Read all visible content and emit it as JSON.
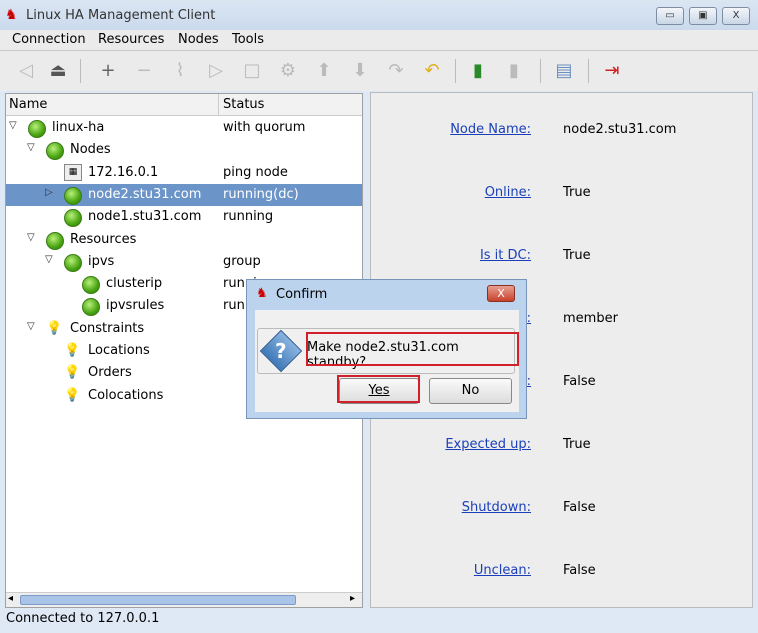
{
  "window": {
    "title": "Linux HA Management Client",
    "minimize": "▭",
    "maximize": "▣",
    "close": "X"
  },
  "menu": [
    "Connection",
    "Resources",
    "Nodes",
    "Tools"
  ],
  "toolbar": [
    "disconnect-icon",
    "connect-icon",
    "add-icon",
    "remove-icon",
    "cleanup-icon",
    "start-icon",
    "stop-icon",
    "manage-icon",
    "migrate-up-icon",
    "migrate-down-icon",
    "redo-icon",
    "undo-icon",
    "standby-icon",
    "active-icon",
    "view-icon",
    "exit-icon"
  ],
  "tree": {
    "headers": {
      "name": "Name",
      "status": "Status"
    },
    "rows": [
      {
        "name": "linux-ha",
        "status": "with quorum",
        "level": 0,
        "icon": "led",
        "exp": "open"
      },
      {
        "name": "Nodes",
        "status": "",
        "level": 1,
        "icon": "led",
        "exp": "open"
      },
      {
        "name": "172.16.0.1",
        "status": "ping node",
        "level": 2,
        "icon": "ping"
      },
      {
        "name": "node2.stu31.com",
        "status": "running(dc)",
        "level": 2,
        "icon": "led",
        "exp": "closed",
        "selected": true
      },
      {
        "name": "node1.stu31.com",
        "status": "running",
        "level": 2,
        "icon": "led"
      },
      {
        "name": "Resources",
        "status": "",
        "level": 1,
        "icon": "led",
        "exp": "open"
      },
      {
        "name": "ipvs",
        "status": "group",
        "level": 2,
        "icon": "led",
        "exp": "open"
      },
      {
        "name": "clusterip",
        "status": "running",
        "level": 3,
        "icon": "led"
      },
      {
        "name": "ipvsrules",
        "status": "running",
        "level": 3,
        "icon": "led"
      },
      {
        "name": "Constraints",
        "status": "",
        "level": 1,
        "icon": "bulb",
        "exp": "open"
      },
      {
        "name": "Locations",
        "status": "",
        "level": 2,
        "icon": "bulb"
      },
      {
        "name": "Orders",
        "status": "",
        "level": 2,
        "icon": "bulb"
      },
      {
        "name": "Colocations",
        "status": "",
        "level": 2,
        "icon": "bulb"
      }
    ]
  },
  "details": [
    {
      "label": "Node Name:",
      "value": "node2.stu31.com"
    },
    {
      "label": "Online:",
      "value": "True"
    },
    {
      "label": "Is it DC:",
      "value": "True"
    },
    {
      "label": ":",
      "value": "member"
    },
    {
      "label": "y:",
      "value": "False"
    },
    {
      "label": "Expected up:",
      "value": "True"
    },
    {
      "label": "Shutdown:",
      "value": "False"
    },
    {
      "label": "Unclean:",
      "value": "False"
    }
  ],
  "statusbar": "Connected to 127.0.0.1",
  "dialog": {
    "title": "Confirm",
    "message": "Make node2.stu31.com standby?",
    "yes": "Yes",
    "no": "No",
    "close": "X"
  }
}
